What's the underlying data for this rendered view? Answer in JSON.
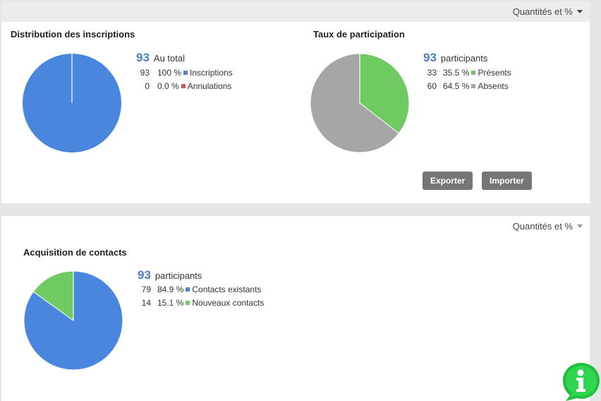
{
  "panels": [
    {
      "dropdown_label": "Quantités et %",
      "charts": [
        {
          "title": "Distribution des inscriptions",
          "total": "93",
          "total_label": "Au total",
          "rows": [
            {
              "count": "93",
              "pct": "100 %",
              "label": "Inscriptions",
              "color": "#4a86dd"
            },
            {
              "count": "0",
              "pct": "0.0 %",
              "label": "Annulations",
              "color": "#d9534f"
            }
          ]
        },
        {
          "title": "Taux de participation",
          "total": "93",
          "total_label": "participants",
          "rows": [
            {
              "count": "33",
              "pct": "35.5 %",
              "label": "Présents",
              "color": "#6fcb61"
            },
            {
              "count": "60",
              "pct": "64.5 %",
              "label": "Absents",
              "color": "#a6a6a6"
            }
          ]
        }
      ],
      "buttons": {
        "export": "Exporter",
        "import": "Importer"
      }
    },
    {
      "dropdown_label": "Quantités et %",
      "charts": [
        {
          "title": "Acquisition de contacts",
          "total": "93",
          "total_label": "participants",
          "rows": [
            {
              "count": "79",
              "pct": "84.9 %",
              "label": "Contacts existants",
              "color": "#4a86dd"
            },
            {
              "count": "14",
              "pct": "15.1 %",
              "label": "Nouveaux contacts",
              "color": "#6fcb61"
            }
          ]
        }
      ]
    }
  ],
  "help_badge": {
    "icon": "info-icon",
    "color": "#1fbf3f"
  },
  "chart_data": [
    {
      "type": "pie",
      "title": "Distribution des inscriptions",
      "categories": [
        "Inscriptions",
        "Annulations"
      ],
      "values": [
        93,
        0
      ],
      "percentages": [
        100,
        0.0
      ],
      "colors": [
        "#4a86dd",
        "#d9534f"
      ]
    },
    {
      "type": "pie",
      "title": "Taux de participation",
      "categories": [
        "Présents",
        "Absents"
      ],
      "values": [
        33,
        60
      ],
      "percentages": [
        35.5,
        64.5
      ],
      "colors": [
        "#6fcb61",
        "#a6a6a6"
      ]
    },
    {
      "type": "pie",
      "title": "Acquisition de contacts",
      "categories": [
        "Contacts existants",
        "Nouveaux contacts"
      ],
      "values": [
        79,
        14
      ],
      "percentages": [
        84.9,
        15.1
      ],
      "colors": [
        "#4a86dd",
        "#6fcb61"
      ]
    }
  ]
}
